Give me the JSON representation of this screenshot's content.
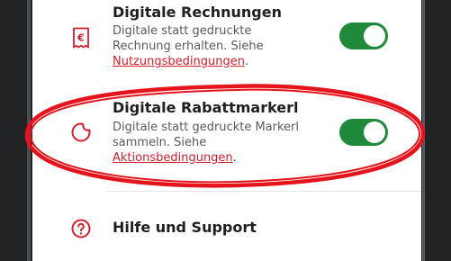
{
  "settings": {
    "invoices": {
      "title": "Digitale Rechnungen",
      "desc_line1": "Digitale statt gedruckte",
      "desc_line2": "Rechnung erhalten. Siehe",
      "link": "Nutzungsbedingungen",
      "suffix": ".",
      "icon": "receipt-euro-icon",
      "enabled": true
    },
    "stickers": {
      "title": "Digitale Rabattmarkerl",
      "desc_line1": "Digitale statt gedruckte Markerl",
      "desc_line2": "sammeln. Siehe",
      "link": "Aktionsbedingungen",
      "suffix": ".",
      "icon": "sticker-icon",
      "enabled": true
    },
    "help": {
      "title": "Hilfe und Support",
      "icon": "help-circle-icon"
    }
  },
  "colors": {
    "accent": "#d31f2e",
    "toggle_on": "#1f8a3c",
    "highlight": "#e5141c"
  }
}
